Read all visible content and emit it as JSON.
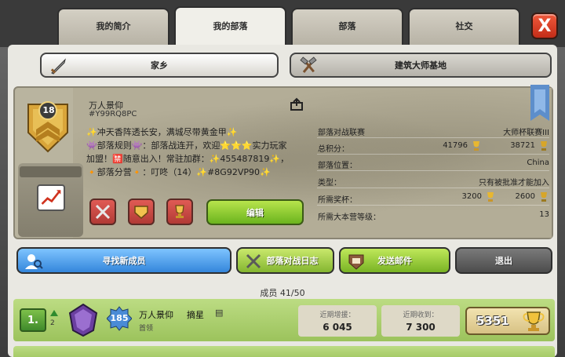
{
  "tabs": [
    {
      "label": "我的简介"
    },
    {
      "label": "我的部落"
    },
    {
      "label": "部落"
    },
    {
      "label": "社交"
    }
  ],
  "close_label": "X",
  "subtabs": {
    "home": "家乡",
    "builder": "建筑大师基地"
  },
  "clan": {
    "level": "18",
    "name": "万人景仰",
    "tag": "#Y99RQ8PC",
    "description": [
      "✨冲天香阵透长安，满城尽带黄金甲✨",
      "👾部落规则👾：部落战连开，欢迎⭐⭐⭐实力玩家",
      "加盟！🈲随意出入！常驻加群：✨455487819✨，",
      "🔸部落分营🔸：叮咚（14）✨#8G92VP90✨"
    ],
    "edit_label": "编辑"
  },
  "info": {
    "war_league_label": "部落对战联赛",
    "war_league_value": "大师杯联赛III",
    "total_points_label": "总积分：",
    "total_points_home": "41796",
    "total_points_builder": "38721",
    "location_label": "部落位置：",
    "location_value": "China",
    "type_label": "类型：",
    "type_value": "只有被批准才能加入",
    "required_trophies_label": "所需奖杯：",
    "required_trophies_home": "3200",
    "required_trophies_builder": "2600",
    "required_th_label": "所需大本营等级：",
    "required_th_value": "13"
  },
  "actions": {
    "find": "寻找新成员",
    "war_log": "部落对战日志",
    "send_mail": "发送邮件",
    "leave": "退出"
  },
  "members": {
    "title": "成员 41/50",
    "rows": [
      {
        "rank": "1.",
        "rank_change": "2",
        "xp_level": "185",
        "name": "万人景仰",
        "suffix": "摘星",
        "role": "首领",
        "donated_label": "近期增援：",
        "donated": "6 045",
        "received_label": "近期收到：",
        "received": "7 300",
        "trophies": "5351"
      }
    ]
  },
  "colors": {
    "accent_green": "#84b630",
    "accent_blue": "#3486db",
    "close_red": "#c42d18"
  }
}
